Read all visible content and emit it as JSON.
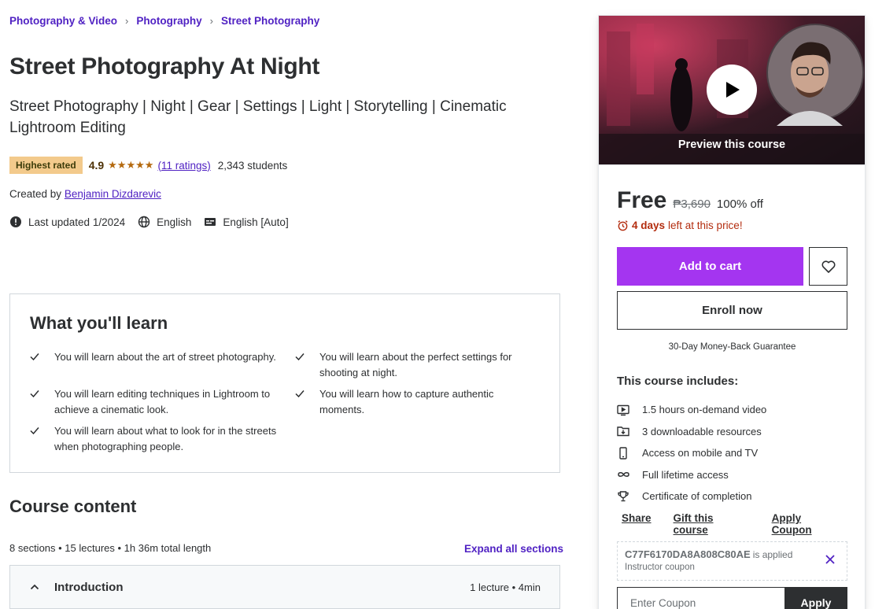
{
  "breadcrumb": [
    "Photography & Video",
    "Photography",
    "Street Photography"
  ],
  "course": {
    "title": "Street Photography At Night",
    "subtitle": "Street Photography | Night | Gear | Settings | Light | Storytelling | Cinematic Lightroom Editing",
    "badge": "Highest rated",
    "rating": "4.9",
    "stars": "★★★★★",
    "ratings_link": "(11 ratings)",
    "students": "2,343 students",
    "created_by_label": "Created by",
    "instructor": "Benjamin Dizdarevic",
    "last_updated": "Last updated 1/2024",
    "language": "English",
    "captions": "English [Auto]"
  },
  "learn": {
    "heading": "What you'll learn",
    "items": [
      "You will learn about the art of street photography.",
      "You will learn about the perfect settings for shooting at night.",
      "You will learn editing techniques in Lightroom to achieve a cinematic look.",
      "You will learn how to capture authentic moments.",
      "You will learn about what to look for in the streets when photographing people."
    ]
  },
  "content": {
    "heading": "Course content",
    "summary": "8 sections • 15 lectures • 1h 36m total length",
    "expand_all": "Expand all sections",
    "sections": [
      {
        "title": "Introduction",
        "meta": "1 lecture • 4min"
      }
    ]
  },
  "sidebar": {
    "preview_label": "Preview this course",
    "price": "Free",
    "original_price": "₱3,690",
    "discount": "100% off",
    "timer_days": "4 days",
    "timer_rest": "left at this price!",
    "add_to_cart": "Add to cart",
    "enroll_now": "Enroll now",
    "guarantee": "30-Day Money-Back Guarantee",
    "includes_title": "This course includes:",
    "includes": [
      {
        "icon": "video-icon",
        "text": "1.5 hours on-demand video"
      },
      {
        "icon": "folder-download-icon",
        "text": "3 downloadable resources"
      },
      {
        "icon": "mobile-icon",
        "text": "Access on mobile and TV"
      },
      {
        "icon": "infinity-icon",
        "text": "Full lifetime access"
      },
      {
        "icon": "trophy-icon",
        "text": "Certificate of completion"
      }
    ],
    "actions": [
      "Share",
      "Gift this course",
      "Apply Coupon"
    ],
    "coupon_code": "C77F6170DA8A808C80AE",
    "coupon_applied": "is applied",
    "coupon_type": "Instructor coupon",
    "coupon_placeholder": "Enter Coupon",
    "apply": "Apply"
  },
  "colors": {
    "brand_purple": "#a435f0",
    "link_purple": "#5022c3",
    "star": "#b4690e",
    "badge": "#f3ca8c",
    "timer_red": "#b32d0f"
  }
}
